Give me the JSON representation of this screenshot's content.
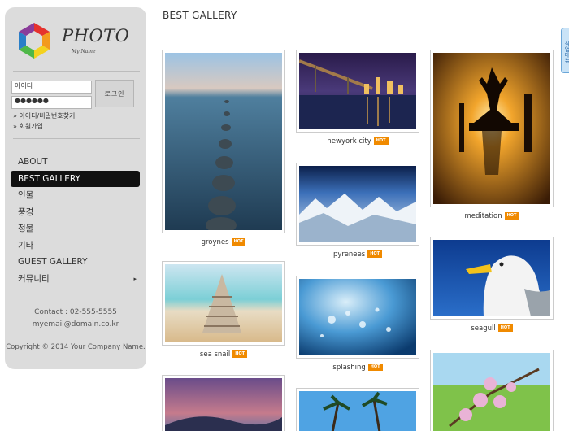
{
  "brand": {
    "logo_text": "PHOTO",
    "logo_sub": "My Name"
  },
  "login": {
    "id_value": "아이디",
    "pw_masked": "●●●●●●",
    "button": "로그인",
    "find_link": "» 아이디/비밀번호찾기",
    "signup_link": "» 회원가입"
  },
  "nav": [
    {
      "label": "ABOUT"
    },
    {
      "label": "BEST GALLERY"
    },
    {
      "label": "인물"
    },
    {
      "label": "풍경"
    },
    {
      "label": "정물"
    },
    {
      "label": "기타"
    },
    {
      "label": "GUEST GALLERY"
    },
    {
      "label": "커뮤니티"
    }
  ],
  "nav_arrow": "▸",
  "contact": {
    "phone": "Contact : 02-555-5555",
    "email": "myemail@domain.co.kr",
    "copyright": "Copyright © 2014 Your Company Name."
  },
  "main": {
    "title": "BEST GALLERY"
  },
  "hot_badge": "HOT",
  "gallery": [
    {
      "caption": "groynes"
    },
    {
      "caption": "newyork city"
    },
    {
      "caption": "meditation"
    },
    {
      "caption": "pyrenees"
    },
    {
      "caption": "seagull"
    },
    {
      "caption": "sea snail"
    },
    {
      "caption": "splashing"
    }
  ],
  "side_tab": "작업메뉴"
}
